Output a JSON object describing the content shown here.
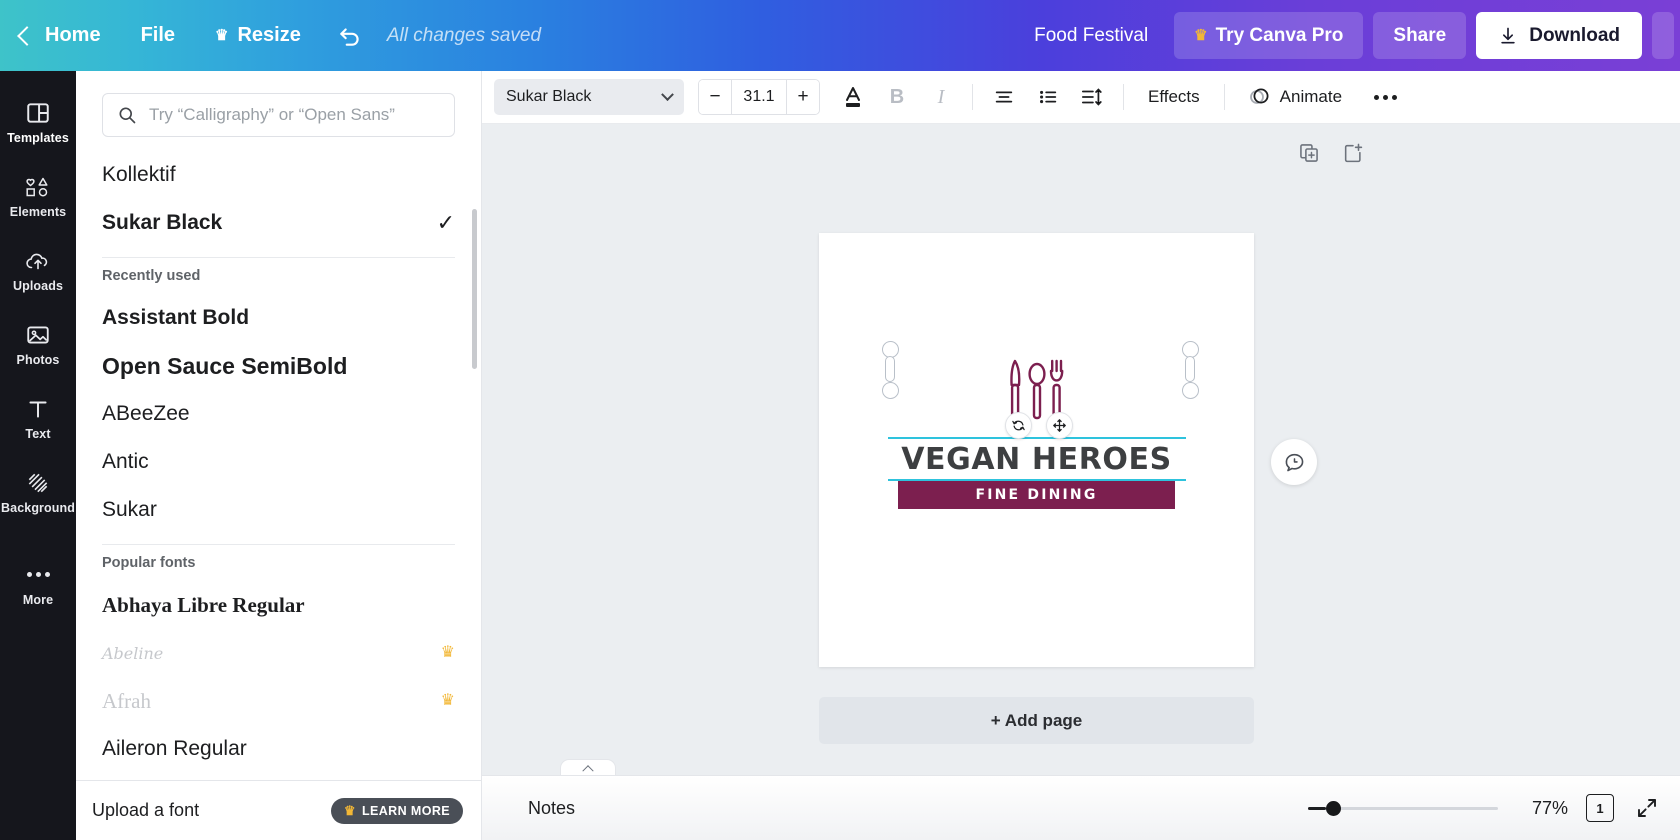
{
  "topbar": {
    "back_icon": "chevron-left-icon",
    "home_label": "Home",
    "file_label": "File",
    "resize_label": "Resize",
    "resize_crown": "♛",
    "undo_icon": "undo-arrow-icon",
    "status_text": "All changes saved",
    "doc_title": "Food Festival",
    "try_pro_label": "Try Canva Pro",
    "try_pro_crown": "♛",
    "share_label": "Share",
    "download_label": "Download",
    "download_icon": "download-icon"
  },
  "rail": {
    "items": [
      {
        "label": "Templates",
        "icon": "templates-grid-icon",
        "active": true
      },
      {
        "label": "Elements",
        "icon": "elements-shapes-icon",
        "active": false
      },
      {
        "label": "Uploads",
        "icon": "cloud-upload-icon",
        "active": false
      },
      {
        "label": "Photos",
        "icon": "photo-image-icon",
        "active": false
      },
      {
        "label": "Text",
        "icon": "text-t-icon",
        "active": false
      },
      {
        "label": "Background",
        "icon": "background-hatch-icon",
        "active": false
      },
      {
        "label": "More",
        "icon": "more-dots-icon",
        "active": false
      }
    ]
  },
  "panel": {
    "search_placeholder": "Try “Calligraphy” or “Open Sans”",
    "search_value": "",
    "search_icon": "search-icon",
    "current_fonts": [
      {
        "name": "Kollektif",
        "style": "regular",
        "selected": false,
        "pro": false
      },
      {
        "name": "Sukar Black",
        "style": "bold",
        "selected": true,
        "pro": false
      }
    ],
    "recent_heading": "Recently used",
    "recent_fonts": [
      {
        "name": "Assistant Bold",
        "style": "bold",
        "pro": false
      },
      {
        "name": "Open Sauce SemiBold",
        "style": "semibold",
        "pro": false
      },
      {
        "name": "ABeeZee",
        "style": "regular",
        "pro": false
      },
      {
        "name": "Antic",
        "style": "regular",
        "pro": false
      },
      {
        "name": "Sukar",
        "style": "regular",
        "pro": false
      }
    ],
    "popular_heading": "Popular fonts",
    "popular_fonts": [
      {
        "name": "Abhaya Libre Regular",
        "style": "serif",
        "pro": false
      },
      {
        "name": "Abeline",
        "style": "script",
        "pro": true
      },
      {
        "name": "Afrah",
        "style": "faded",
        "pro": true
      },
      {
        "name": "Aileron Regular",
        "style": "regular",
        "pro": false
      }
    ],
    "check_glyph": "✓",
    "crown_glyph": "♛",
    "upload_label": "Upload a font",
    "learn_more_label": "LEARN MORE",
    "learn_more_crown": "♛"
  },
  "toolbar": {
    "font_name": "Sukar Black",
    "font_size": "31.1",
    "decrease_label": "−",
    "increase_label": "+",
    "text_color_icon": "text-color-a-icon",
    "bold_label": "B",
    "italic_label": "I",
    "align_icon": "align-center-icon",
    "list_icon": "bullet-list-icon",
    "spacing_icon": "line-spacing-icon",
    "effects_label": "Effects",
    "animate_label": "Animate",
    "animate_icon": "animate-icon",
    "more_icon": "more-horizontal-icon"
  },
  "canvas": {
    "duplicate_page_icon": "duplicate-page-icon",
    "add_page_icon": "add-page-icon",
    "comment_icon": "comment-bubble-icon",
    "rotate_icon": "rotate-icon",
    "move_icon": "move-icon",
    "add_page_label": "+ Add page",
    "design": {
      "cutlery_icon": "knife-spoon-fork-icon",
      "title": "VEGAN HEROES",
      "subtitle": "FINE DINING",
      "accent_color": "#2ec3dd",
      "banner_color": "#7c1f4f",
      "title_color": "#3d3f41",
      "cutlery_color": "#7c1f4f"
    }
  },
  "bottombar": {
    "notes_label": "Notes",
    "collapse_icon": "chevron-up-icon",
    "zoom_percent": "77%",
    "page_count": "1",
    "expand_icon": "expand-fullscreen-icon"
  }
}
